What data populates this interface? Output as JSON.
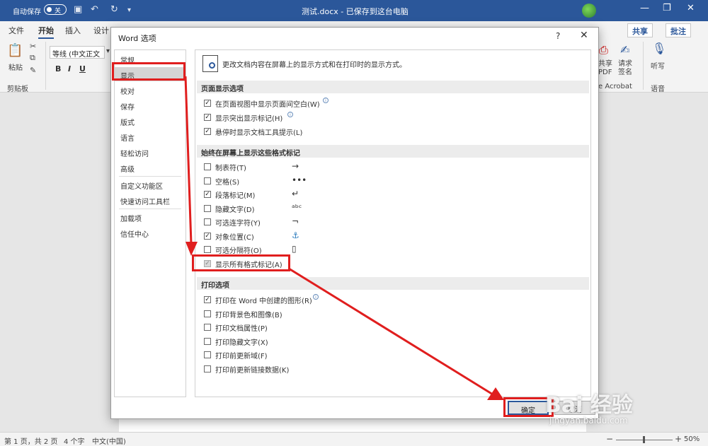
{
  "titlebar": {
    "autosave_label": "自动保存",
    "autosave_state": "关",
    "title": "测试.docx  -  已保存到这台电脑",
    "min": "—",
    "restore": "❐",
    "close": "✕"
  },
  "ribbon": {
    "tabs": [
      "文件",
      "开始",
      "插入",
      "设计"
    ],
    "active_tab": "开始",
    "share": "共享",
    "comment": "批注",
    "paste": "粘贴",
    "clipboard": "剪贴板",
    "font_name": "等线 (中文正文",
    "bold": "B",
    "italic": "I",
    "underline": "U",
    "share_pdf": "共享\nPDF",
    "request_sign": "请求\n签名",
    "acrobat": "e Acrobat",
    "dictate": "听写",
    "voice": "语音"
  },
  "dialog": {
    "title": "Word 选项",
    "help": "?",
    "close": "✕",
    "nav": [
      "常规",
      "显示",
      "校对",
      "保存",
      "版式",
      "语言",
      "轻松访问",
      "高级",
      "自定义功能区",
      "快速访问工具栏",
      "加载项",
      "信任中心"
    ],
    "active_nav": "显示",
    "header": "更改文档内容在屏幕上的显示方式和在打印时的显示方式。",
    "sections": {
      "page_display": "页面显示选项",
      "format_marks": "始终在屏幕上显示这些格式标记",
      "print": "打印选项"
    },
    "page_options": [
      {
        "label": "在页面视图中显示页面间空白(W)",
        "checked": true,
        "info": true
      },
      {
        "label": "显示突出显示标记(H)",
        "checked": true,
        "info": true
      },
      {
        "label": "悬停时显示文档工具提示(L)",
        "checked": true,
        "info": false
      }
    ],
    "format_options": [
      {
        "label": "制表符(T)",
        "checked": false,
        "symbol": "→"
      },
      {
        "label": "空格(S)",
        "checked": false,
        "symbol": "•••"
      },
      {
        "label": "段落标记(M)",
        "checked": true,
        "symbol": "↵"
      },
      {
        "label": "隐藏文字(D)",
        "checked": false,
        "symbol": "ᵃᵇᶜ"
      },
      {
        "label": "可选连字符(Y)",
        "checked": false,
        "symbol": "¬"
      },
      {
        "label": "对象位置(C)",
        "checked": true,
        "symbol": "⚓"
      },
      {
        "label": "可选分隔符(O)",
        "checked": false,
        "symbol": "▯"
      }
    ],
    "show_all_marks": {
      "label": "显示所有格式标记(A)",
      "checked": true,
      "disabled": true
    },
    "print_options": [
      {
        "label": "打印在 Word 中创建的图形(R)",
        "checked": true,
        "info": true
      },
      {
        "label": "打印背景色和图像(B)",
        "checked": false,
        "info": false
      },
      {
        "label": "打印文档属性(P)",
        "checked": false,
        "info": false
      },
      {
        "label": "打印隐藏文字(X)",
        "checked": false,
        "info": false
      },
      {
        "label": "打印前更新域(F)",
        "checked": false,
        "info": false
      },
      {
        "label": "打印前更新链接数据(K)",
        "checked": false,
        "info": false
      }
    ],
    "ok": "确定",
    "cancel": "取消"
  },
  "statusbar": {
    "page": "第 1 页，共 2 页",
    "words": "4 个字",
    "language": "中文(中国)",
    "zoom": "50%",
    "minus": "−",
    "plus": "+"
  },
  "watermark": {
    "main": "Bai 经验",
    "sub": "jingyan.baidu.com"
  },
  "colors": {
    "accent": "#2b579a",
    "annotation": "#e01e1e"
  }
}
